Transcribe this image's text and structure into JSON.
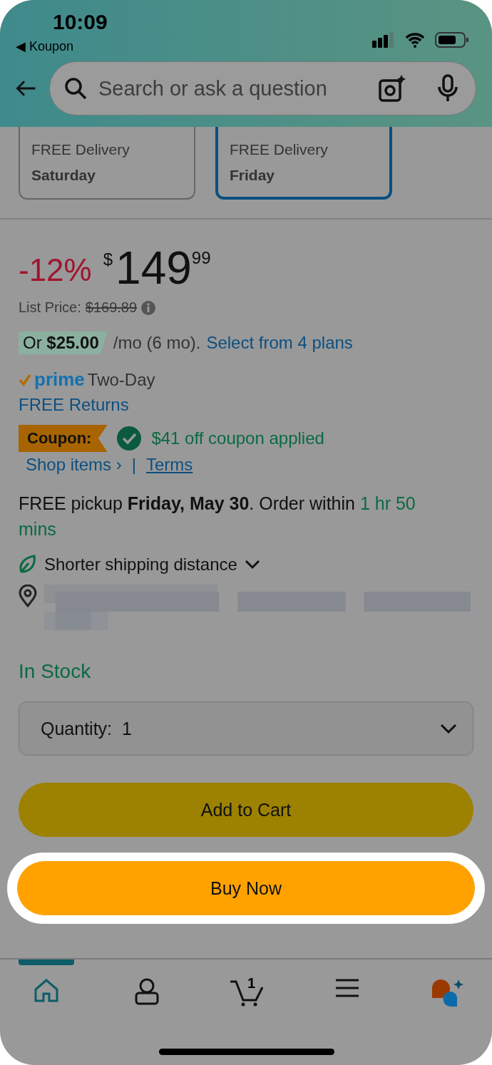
{
  "status_bar": {
    "time": "10:09",
    "back_app": "◀ Koupon"
  },
  "search": {
    "placeholder": "Search or ask a question"
  },
  "delivery_options": [
    {
      "line1": "FREE Delivery",
      "day": "Saturday",
      "selected": false
    },
    {
      "line1": "FREE Delivery",
      "day": "Friday",
      "selected": true
    }
  ],
  "price": {
    "discount": "-12%",
    "currency": "$",
    "whole": "149",
    "fraction": "99",
    "list_label": "List Price:",
    "list_price": "$169.89"
  },
  "installment": {
    "badge": "Or **$25.00**",
    "text": "/mo (6 mo).",
    "link": "Select from 4 plans"
  },
  "prime": {
    "logo": "prime",
    "speed": "Two-Day"
  },
  "returns": "FREE Returns",
  "coupon": {
    "badge": "Coupon:",
    "text": "$41 off coupon applied",
    "shop": "Shop items ›",
    "separator": "|",
    "terms": "Terms"
  },
  "pickup": {
    "text": "FREE pickup **Friday, May 30**. Order within",
    "countdown": "1 hr 50 mins"
  },
  "shipping": {
    "label": "Shorter shipping distance"
  },
  "stock": "In Stock",
  "quantity": {
    "label": "Quantity:",
    "value": "1"
  },
  "buttons": [
    {
      "label": "Add to Cart",
      "kind": "cart",
      "highlighted": false
    },
    {
      "label": "Buy Now",
      "kind": "buy",
      "highlighted": true
    }
  ],
  "nav": [
    {
      "kind": "home",
      "selected": true
    },
    {
      "kind": "account",
      "selected": false
    },
    {
      "kind": "cart",
      "selected": false,
      "badge": "1"
    },
    {
      "kind": "menu",
      "selected": false
    },
    {
      "kind": "assistant",
      "selected": false
    }
  ]
}
